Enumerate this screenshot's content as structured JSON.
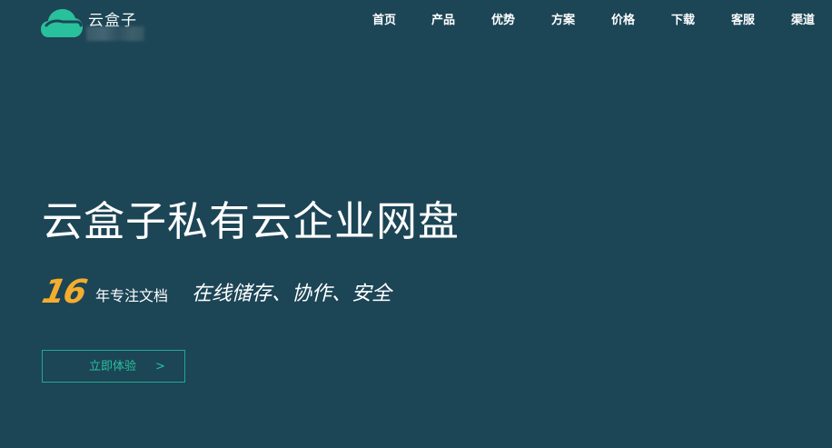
{
  "header": {
    "brand_name": "云盒子",
    "nav_items": [
      {
        "label": "首页"
      },
      {
        "label": "产品"
      },
      {
        "label": "优势"
      },
      {
        "label": "方案"
      },
      {
        "label": "价格"
      },
      {
        "label": "下载"
      },
      {
        "label": "客服"
      },
      {
        "label": "渠道"
      }
    ]
  },
  "hero": {
    "title": "云盒子私有云企业网盘",
    "years_number": "16",
    "years_text": "年专注文档",
    "slogan": "在线储存、协作、安全",
    "cta_label": "立即体验",
    "cta_arrow": ">"
  },
  "colors": {
    "background": "#1c4556",
    "brand_green": "#28c19c",
    "accent_orange": "#f4ad2d"
  },
  "icons": {
    "logo": "cloud-icon"
  }
}
